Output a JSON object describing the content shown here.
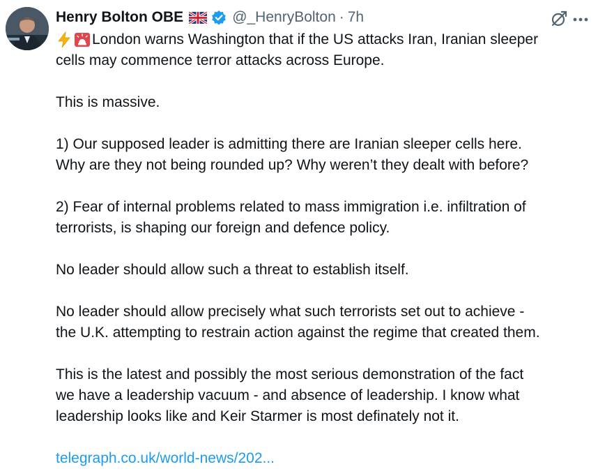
{
  "author": {
    "name": "Henry Bolton OBE",
    "handle": "@_HenryBolton",
    "separator": "·",
    "time": "7h"
  },
  "icons": {
    "avatar": "profile-photo",
    "flag": "uk-flag-icon",
    "verified": "verified-badge-icon",
    "grok": "grok-icon",
    "more": "more-options-icon",
    "lightning": "high-voltage-emoji",
    "siren": "police-light-emoji"
  },
  "colors": {
    "text": "#0f1419",
    "secondary": "#536471",
    "link": "#1d9bf0",
    "verified": "#1d9bf0"
  },
  "tweet": {
    "lines": [
      "London warns Washington that if the US attacks Iran, Iranian sleeper",
      "cells may commence terror attacks across Europe.",
      "This is massive.",
      "1) Our supposed leader is admitting there are Iranian sleeper cells here.",
      "Why are they not being rounded up? Why weren’t they dealt with before?",
      "2) Fear of internal problems related to mass immigration i.e. infiltration of",
      "terrorists, is shaping our foreign and defence policy.",
      "No leader should allow such a threat to establish itself.",
      "No leader should allow precisely what such terrorists set out to achieve -",
      "the U.K. attempting to restrain action against the regime that created them.",
      "This is the latest and possibly the most serious demonstration of the fact",
      "we have a leadership vacuum - and absence of leadership. I know what",
      "leadership looks like and Keir Starmer is most definately not it."
    ],
    "link": "telegraph.co.uk/world-news/202..."
  }
}
